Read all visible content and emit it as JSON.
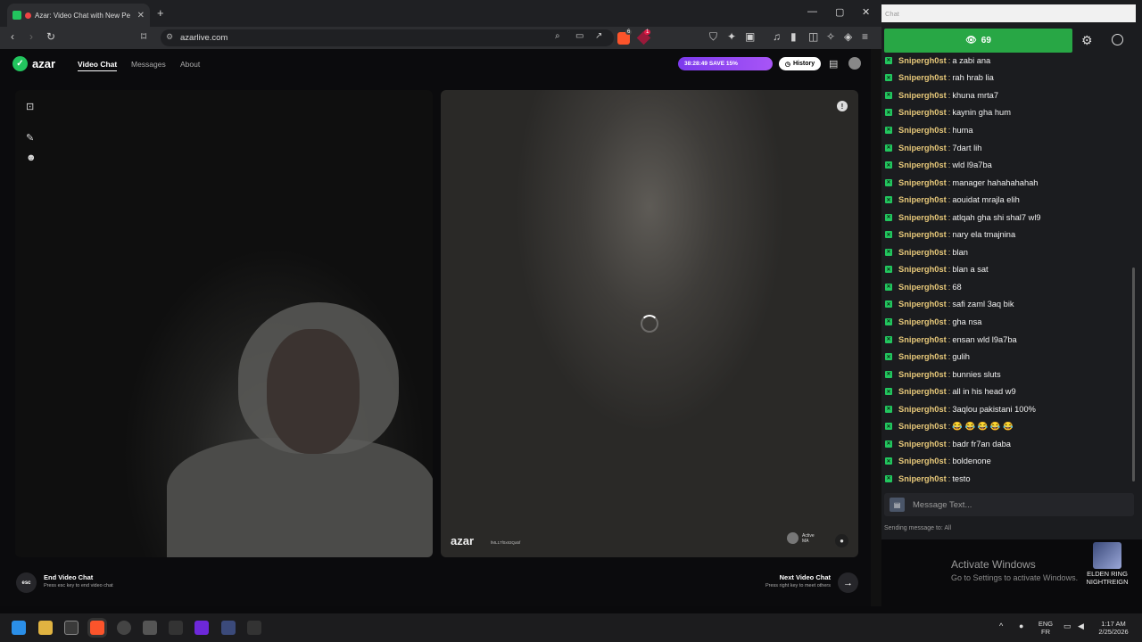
{
  "browser": {
    "tab_title": "Azar: Video Chat with New Pe",
    "tab_close": "✕",
    "new_tab": "+",
    "url": "azarlive.com",
    "win_min": "—",
    "win_max": "▢",
    "win_close": "✕",
    "shield_badge": "6",
    "alert_badge": "1"
  },
  "azar": {
    "logo": "azar",
    "nav": {
      "video_chat": "Video Chat",
      "messages": "Messages",
      "about": "About"
    },
    "promo": "38:28:49  SAVE 15%",
    "history": "History",
    "remote": {
      "watermark_logo": "azar",
      "watermark_id": "fML17f0x83Qa5f",
      "user_status": "Active",
      "user_country": "MA"
    },
    "end": {
      "key": "esc",
      "title": "End Video Chat",
      "subtitle": "Press esc key to end video chat"
    },
    "next": {
      "title": "Next Video Chat",
      "subtitle": "Press right key to meet others",
      "arrow": "→"
    }
  },
  "chat": {
    "window_title": "Chat",
    "viewer_count": "69",
    "messages": [
      {
        "user": "Snipergh0st",
        "text": "a zabi ana"
      },
      {
        "user": "Snipergh0st",
        "text": "rah hrab lia"
      },
      {
        "user": "Snipergh0st",
        "text": "khuna mrta7"
      },
      {
        "user": "Snipergh0st",
        "text": "kaynin gha hum"
      },
      {
        "user": "Snipergh0st",
        "text": "huma"
      },
      {
        "user": "Snipergh0st",
        "text": "7dart lih"
      },
      {
        "user": "Snipergh0st",
        "text": "wld l9a7ba"
      },
      {
        "user": "Snipergh0st",
        "text": "manager hahahahahah"
      },
      {
        "user": "Snipergh0st",
        "text": "aouidat mrajla elih"
      },
      {
        "user": "Snipergh0st",
        "text": "atlqah gha shi shal7 wl9"
      },
      {
        "user": "Snipergh0st",
        "text": "nary ela tmajnina"
      },
      {
        "user": "Snipergh0st",
        "text": "blan"
      },
      {
        "user": "Snipergh0st",
        "text": "blan a sat"
      },
      {
        "user": "Snipergh0st",
        "text": "68"
      },
      {
        "user": "Snipergh0st",
        "text": "safi zaml 3aq bik"
      },
      {
        "user": "Snipergh0st",
        "text": "gha nsa"
      },
      {
        "user": "Snipergh0st",
        "text": "ensan wld l9a7ba"
      },
      {
        "user": "Snipergh0st",
        "text": "gulih"
      },
      {
        "user": "Snipergh0st",
        "text": "bunnies sluts"
      },
      {
        "user": "Snipergh0st",
        "text": "all in his head w9"
      },
      {
        "user": "Snipergh0st",
        "text": "3aqlou pakistani 100%"
      },
      {
        "user": "Snipergh0st",
        "text": "😂 😂 😂 😂 😂"
      },
      {
        "user": "Snipergh0st",
        "text": "badr fr7an daba"
      },
      {
        "user": "Snipergh0st",
        "text": "boldenone"
      },
      {
        "user": "Snipergh0st",
        "text": "testo"
      }
    ],
    "input_placeholder": "Message Text...",
    "sending_to": "Sending message to: All"
  },
  "desktop": {
    "activate_title": "Activate Windows",
    "activate_subtitle": "Go to Settings to activate Windows.",
    "game_label_line1": "ELDEN RING",
    "game_label_line2": "NIGHTREIGN"
  },
  "taskbar": {
    "lang_line1": "ENG",
    "lang_line2": "FR",
    "time": "1:17 AM",
    "date": "2/25/2026"
  },
  "colors": {
    "accent_green": "#28a745",
    "username_gold": "#e8c97a",
    "promo_purple": "#a855f7"
  }
}
